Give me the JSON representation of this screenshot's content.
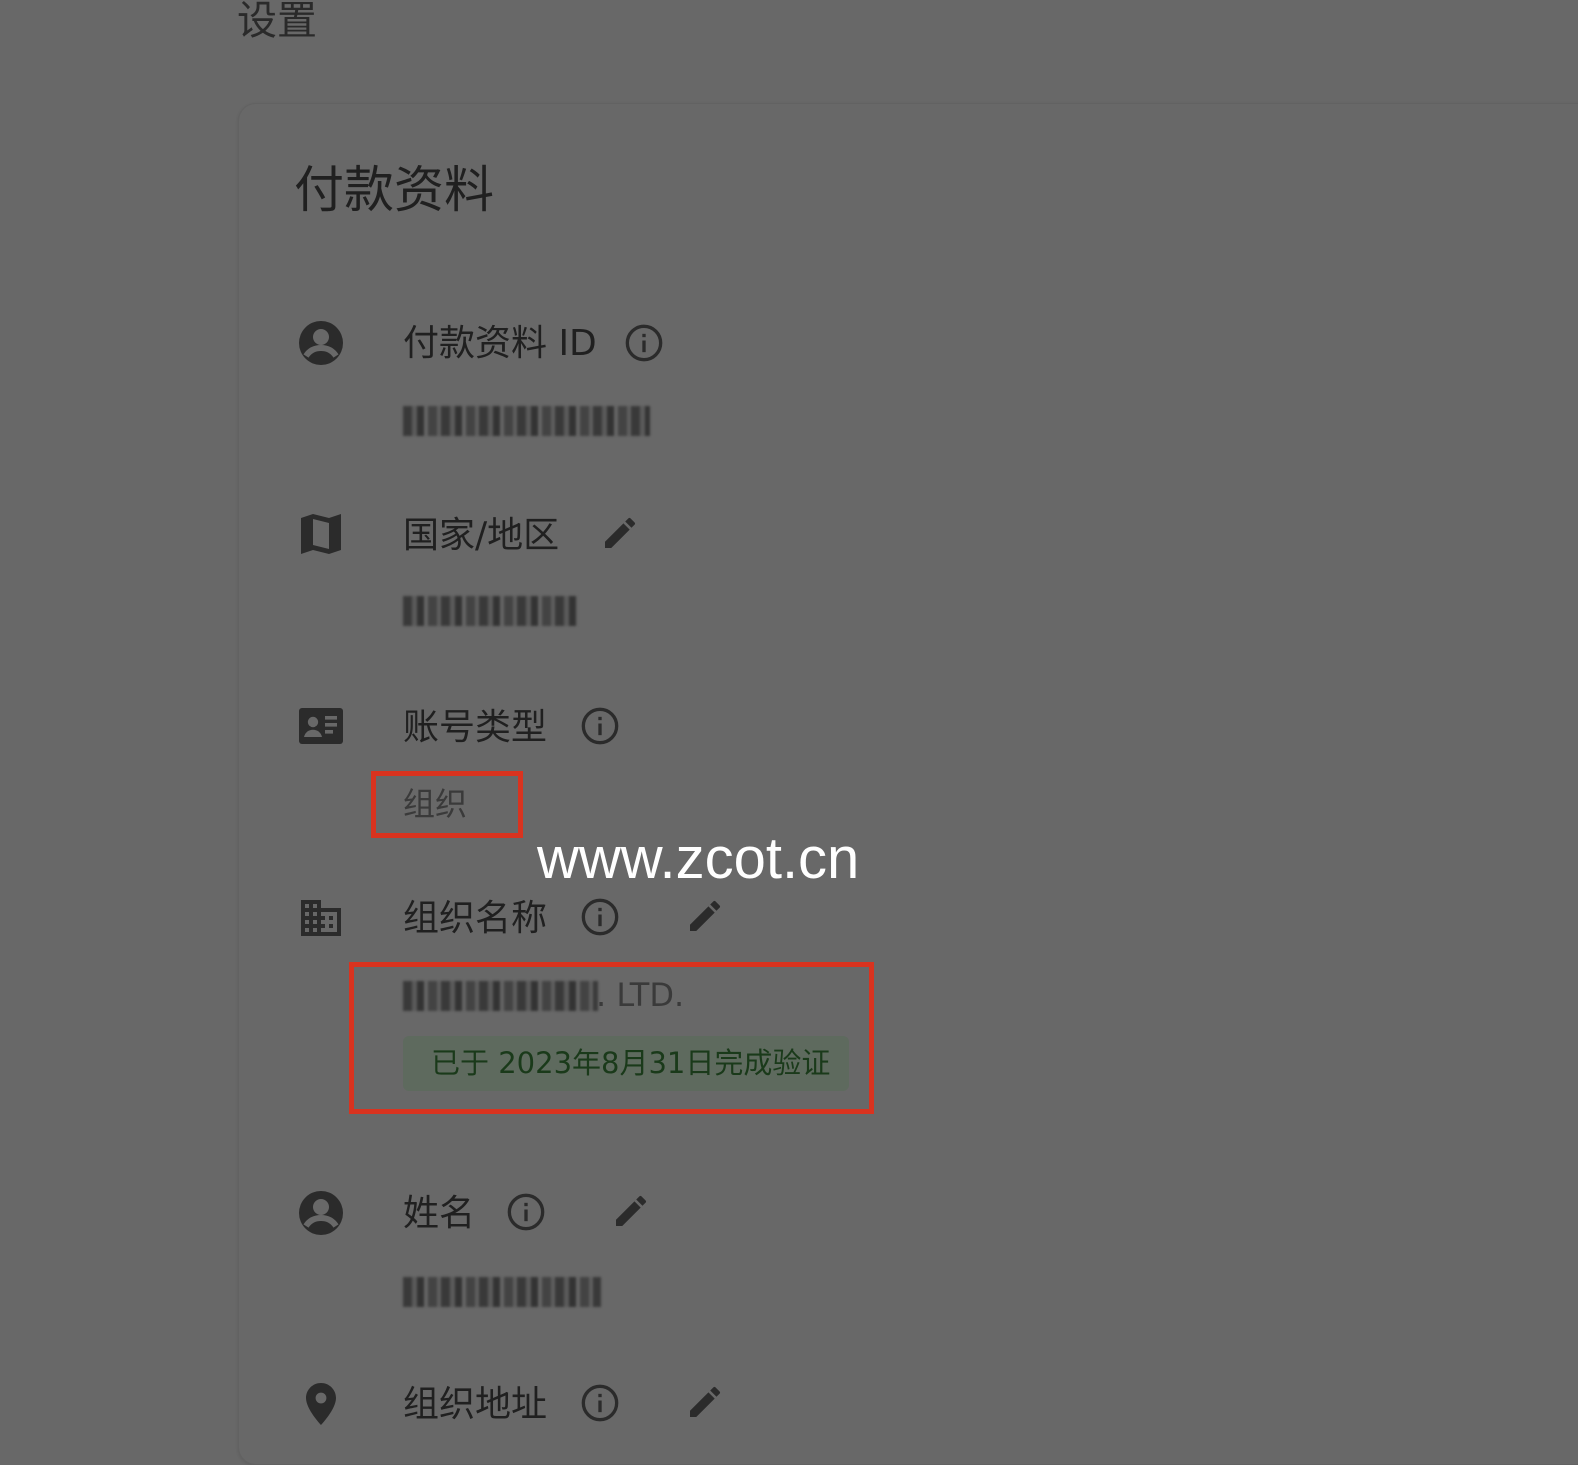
{
  "page": {
    "title": "设置"
  },
  "card": {
    "title": "付款资料"
  },
  "fields": {
    "payment_profile_id": {
      "label": "付款资料 ID"
    },
    "country_region": {
      "label": "国家/地区"
    },
    "account_type": {
      "label": "账号类型",
      "value": "组织"
    },
    "organization_name": {
      "label": "组织名称",
      "value_suffix": ". LTD.",
      "verification": "已于 2023年8月31日完成验证"
    },
    "name": {
      "label": "姓名"
    },
    "organization_address": {
      "label": "组织地址"
    }
  },
  "watermark": "www.zcot.cn",
  "colors": {
    "background": "#686868",
    "text": "#202020",
    "highlight": "#d9331f",
    "verified_text": "#1a3a1a",
    "verified_bg": "#5e6a5e"
  }
}
